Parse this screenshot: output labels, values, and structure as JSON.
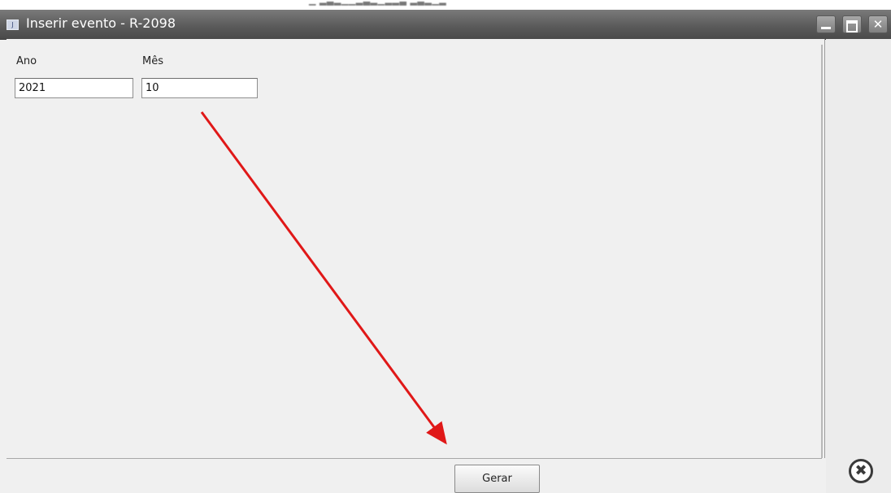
{
  "window": {
    "title": "Inserir evento - R-2098",
    "app_icon": "java-app-icon",
    "background_bleed_text": "▁ ▂▃▂▁▁▂▃▂▁▂▂▃         ▂▃▂▁▂",
    "controls": {
      "minimize_icon": "minimize-icon",
      "maximize_icon": "maximize-icon",
      "close_glyph": "✕"
    }
  },
  "form": {
    "ano": {
      "label": "Ano",
      "value": "2021"
    },
    "mes": {
      "label": "Mês",
      "value": "10"
    }
  },
  "actions": {
    "gerar_label": "Gerar",
    "cancel_glyph": "✖"
  },
  "annotation": {
    "type": "red-arrow",
    "color": "#e01818",
    "points_to": "gerar-button"
  },
  "colors": {
    "titlebar": "#595959",
    "window_bg": "#f0f0f0",
    "arrow": "#e01818"
  }
}
